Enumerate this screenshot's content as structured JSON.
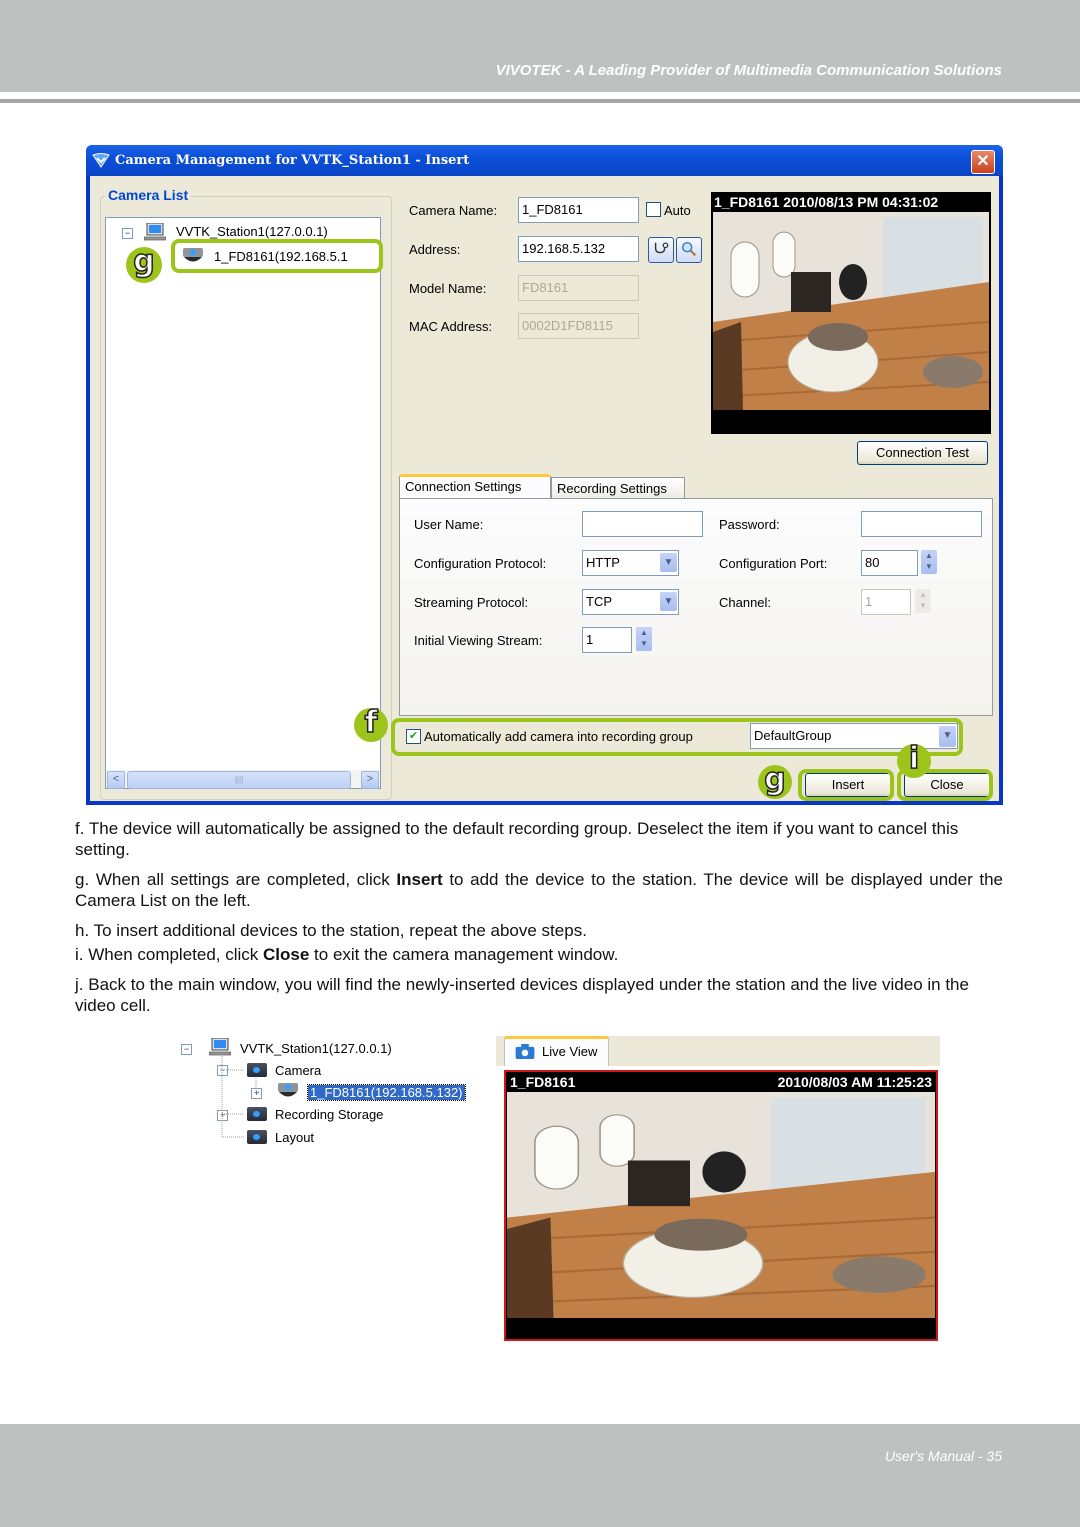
{
  "page": {
    "header_text": "VIVOTEK - A Leading Provider of Multimedia Communication Solutions",
    "footer_text": "User's Manual - 35"
  },
  "dialog": {
    "title": "Camera Management for VVTK_Station1 - Insert",
    "close_glyph": "✕",
    "camera_list": {
      "group_title": "Camera List",
      "station": "VVTK_Station1(127.0.0.1)",
      "camera": "1_FD8161(192.168.5.1",
      "expander_glyph": "−",
      "scroll_left": "<",
      "scroll_right": ">",
      "scroll_grip": "||||"
    },
    "fields": {
      "camera_name_label": "Camera Name:",
      "camera_name_value": "1_FD8161",
      "auto_label": "Auto",
      "auto_checked": false,
      "address_label": "Address:",
      "address_value": "192.168.5.132",
      "model_name_label": "Model Name:",
      "model_name_value": "FD8161",
      "mac_label": "MAC Address:",
      "mac_value": "0002D1FD8115"
    },
    "preview": {
      "caption": "1_FD8161 2010/08/13 PM 04:31:02"
    },
    "connection_test_label": "Connection Test",
    "tabs": [
      {
        "label": "Connection Settings",
        "active": true
      },
      {
        "label": "Recording Settings",
        "active": false
      }
    ],
    "connection": {
      "user_name_label": "User Name:",
      "user_name_value": "",
      "password_label": "Password:",
      "password_value": "",
      "config_protocol_label": "Configuration Protocol:",
      "config_protocol_value": "HTTP",
      "config_port_label": "Configuration Port:",
      "config_port_value": "80",
      "streaming_protocol_label": "Streaming Protocol:",
      "streaming_protocol_value": "TCP",
      "channel_label": "Channel:",
      "channel_value": "1",
      "initial_stream_label": "Initial Viewing Stream:",
      "initial_stream_value": "1"
    },
    "auto_add": {
      "label": "Automatically add camera into recording group",
      "checked": true,
      "check_glyph": "✔",
      "group_value": "DefaultGroup"
    },
    "buttons": {
      "insert": "Insert",
      "close": "Close"
    },
    "callouts": {
      "f": "f",
      "g": "g",
      "i": "i"
    }
  },
  "steps": [
    {
      "letter": "f.",
      "text": "The device will automatically be assigned to the default recording group. Deselect the item if you want to cancel this setting."
    },
    {
      "letter": "g.",
      "pre": "When all settings are completed, click ",
      "bold": "Insert",
      "post": " to add the device to the station. The device will be displayed under the Camera List on the left."
    },
    {
      "letter": "h.",
      "text": "To insert additional devices to the station, repeat the above steps."
    },
    {
      "letter": "i.",
      "pre": "When completed, click ",
      "bold": "Close",
      "post": " to exit the camera management window."
    },
    {
      "letter": "j.",
      "text": "Back to the main window, you will find the newly-inserted devices displayed under the station and the live video in the video cell."
    }
  ],
  "main_window": {
    "tree": {
      "station": "VVTK_Station1(127.0.0.1)",
      "camera_folder": "Camera",
      "camera": "1_FD8161(192.168.5.132)",
      "recording_storage": "Recording Storage",
      "layout": "Layout",
      "minus": "−",
      "plus": "+"
    },
    "live_view": {
      "tab_label": "Live View",
      "camera_name": "1_FD8161",
      "timestamp": "2010/08/03 AM 11:25:23"
    }
  }
}
